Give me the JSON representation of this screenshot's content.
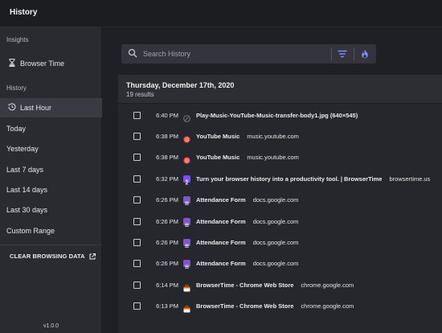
{
  "app": {
    "title": "History",
    "version": "v1.0.0"
  },
  "sidebar": {
    "insights_label": "Insights",
    "browser_time_label": "Browser Time",
    "history_label": "History",
    "items": [
      {
        "label": "Last Hour",
        "active": true,
        "icon": "history-icon"
      },
      {
        "label": "Today"
      },
      {
        "label": "Yesterday"
      },
      {
        "label": "Last 7 days"
      },
      {
        "label": "Last 14 days"
      },
      {
        "label": "Last 30 days"
      },
      {
        "label": "Custom Range"
      }
    ],
    "clear_label": "CLEAR BROWSING DATA"
  },
  "search": {
    "placeholder": "Search History",
    "value": ""
  },
  "results": {
    "date": "Thursday, December 17th, 2020",
    "count": "19 results",
    "rows": [
      {
        "time": "6:40 PM",
        "title": "Play-Music-YouTube-Music-transfer-body1.jpg (640×545)",
        "domain": "",
        "favicon": "globe-icon",
        "color": "#6b6c72"
      },
      {
        "time": "6:38 PM",
        "title": "YouTube Music",
        "domain": "music.youtube.com",
        "favicon": "youtube-music-icon",
        "color": "#e53935"
      },
      {
        "time": "6:38 PM",
        "title": "YouTube Music",
        "domain": "music.youtube.com",
        "favicon": "youtube-music-icon",
        "color": "#e53935"
      },
      {
        "time": "6:32 PM",
        "title": "Turn your browser history into a productivity tool. | BrowserTime",
        "domain": "browsertime.us",
        "favicon": "browsertime-icon",
        "color": "#7c4dff"
      },
      {
        "time": "6:26 PM",
        "title": "Attendance Form",
        "domain": "docs.google.com",
        "favicon": "google-forms-icon",
        "color": "#7e57c2"
      },
      {
        "time": "6:26 PM",
        "title": "Attendance Form",
        "domain": "docs.google.com",
        "favicon": "google-forms-icon",
        "color": "#7e57c2"
      },
      {
        "time": "6:26 PM",
        "title": "Attendance Form",
        "domain": "docs.google.com",
        "favicon": "google-forms-icon",
        "color": "#7e57c2"
      },
      {
        "time": "6:26 PM",
        "title": "Attendance Form",
        "domain": "docs.google.com",
        "favicon": "google-forms-icon",
        "color": "#7e57c2"
      },
      {
        "time": "6:14 PM",
        "title": "BrowserTime - Chrome Web Store",
        "domain": "chrome.google.com",
        "favicon": "chrome-web-store-icon",
        "color": "#ef6c00"
      },
      {
        "time": "6:13 PM",
        "title": "BrowserTime - Chrome Web Store",
        "domain": "chrome.google.com",
        "favicon": "chrome-web-store-icon",
        "color": "#ef6c00"
      }
    ]
  },
  "colors": {
    "accent": "#7b8cff",
    "background": "#1f2025",
    "sidebar": "#2a2b31"
  }
}
